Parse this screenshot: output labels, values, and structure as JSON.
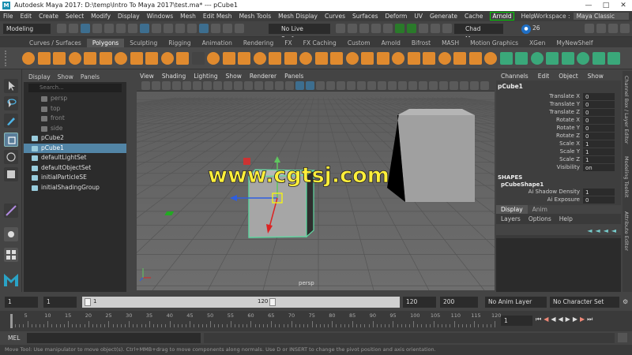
{
  "window": {
    "title": "Autodesk Maya 2017: D:\\temp\\Intro To Maya 2017\\test.ma* --- pCube1"
  },
  "menus": [
    "File",
    "Edit",
    "Create",
    "Select",
    "Modify",
    "Display",
    "Windows",
    "Mesh",
    "Edit Mesh",
    "Mesh Tools",
    "Mesh Display",
    "Curves",
    "Surfaces",
    "Deform",
    "UV",
    "Generate",
    "Cache"
  ],
  "menu_arnold": "Arnold",
  "menu_help": "Help",
  "workspace": {
    "label": "Workspace :",
    "value": "Maya Classic"
  },
  "status": {
    "mode": "Modeling",
    "live_surface": "No Live Surface",
    "user": "Chad Morgan",
    "notifications": "26"
  },
  "shelf_tabs": [
    "Curves / Surfaces",
    "Polygons",
    "Sculpting",
    "Rigging",
    "Animation",
    "Rendering",
    "FX",
    "FX Caching",
    "Custom",
    "Arnold",
    "Bifrost",
    "MASH",
    "Motion Graphics",
    "XGen",
    "MyNewShelf"
  ],
  "shelf_active": "Polygons",
  "outliner": {
    "menus": [
      "Display",
      "Show",
      "Panels"
    ],
    "search_placeholder": "Search...",
    "items": [
      {
        "label": "persp",
        "dim": true
      },
      {
        "label": "top",
        "dim": true
      },
      {
        "label": "front",
        "dim": true
      },
      {
        "label": "side",
        "dim": true
      },
      {
        "label": "pCube2",
        "dim": false
      },
      {
        "label": "pCube1",
        "dim": false,
        "selected": true
      },
      {
        "label": "defaultLightSet",
        "dim": false
      },
      {
        "label": "defaultObjectSet",
        "dim": false
      },
      {
        "label": "initialParticleSE",
        "dim": false
      },
      {
        "label": "initialShadingGroup",
        "dim": false
      }
    ]
  },
  "viewport": {
    "menus": [
      "View",
      "Shading",
      "Lighting",
      "Show",
      "Renderer",
      "Panels"
    ],
    "camera": "persp",
    "watermark": "www.cgtsj.com"
  },
  "channel_box": {
    "menus": [
      "Channels",
      "Edit",
      "Object",
      "Show"
    ],
    "object": "pCube1",
    "attributes": [
      {
        "name": "Translate X",
        "value": "0"
      },
      {
        "name": "Translate Y",
        "value": "0"
      },
      {
        "name": "Translate Z",
        "value": "0"
      },
      {
        "name": "Rotate X",
        "value": "0"
      },
      {
        "name": "Rotate Y",
        "value": "0"
      },
      {
        "name": "Rotate Z",
        "value": "0"
      },
      {
        "name": "Scale X",
        "value": "1"
      },
      {
        "name": "Scale Y",
        "value": "1"
      },
      {
        "name": "Scale Z",
        "value": "1"
      },
      {
        "name": "Visibility",
        "value": "on"
      }
    ],
    "shapes_label": "SHAPES",
    "shape_name": "pCubeShape1",
    "shape_attrs": [
      {
        "name": "Ai Shadow Density",
        "value": "1"
      },
      {
        "name": "Ai Exposure",
        "value": "0"
      }
    ]
  },
  "layer_editor": {
    "tabs": [
      "Display",
      "Anim"
    ],
    "menus": [
      "Layers",
      "Options",
      "Help"
    ]
  },
  "side_tabs": [
    "Channel Box / Layer Editor",
    "Modeling Toolkit",
    "Attribute Editor"
  ],
  "time_range": {
    "start": "1",
    "start_inner": "1",
    "range_start_label": "1",
    "range_end_label": "120",
    "end_inner": "120",
    "end": "200",
    "anim_layer": "No Anim Layer",
    "character_set": "No Character Set"
  },
  "timeline": {
    "ticks": [
      "5",
      "10",
      "15",
      "20",
      "25",
      "30",
      "35",
      "40",
      "45",
      "50",
      "55",
      "60",
      "65",
      "70",
      "75",
      "80",
      "85",
      "90",
      "95",
      "100",
      "105",
      "110",
      "115",
      "120"
    ],
    "current_frame": "1"
  },
  "command_line": {
    "label": "MEL"
  },
  "help_line": "Move Tool: Use manipulator to move object(s). Ctrl+MMB+drag to move components along normals. Use D or INSERT to change the pivot position and axis orientation."
}
